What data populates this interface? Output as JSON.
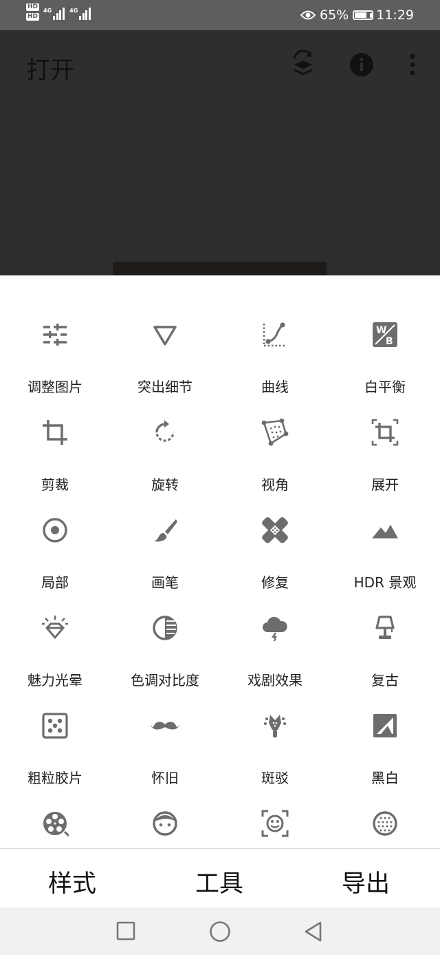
{
  "status_bar": {
    "sim1": "HD",
    "sim2": "HD",
    "net1": "4G",
    "net2": "4G",
    "battery_percent": "65%",
    "battery_level": 0.65,
    "time": "11:29",
    "icons": [
      "eye-comfort-icon",
      "battery-icon"
    ]
  },
  "top_bar": {
    "title": "打开",
    "icons": [
      "layers-undo-icon",
      "info-icon",
      "more-vert-icon"
    ]
  },
  "tools": [
    {
      "label": "调整图片",
      "icon": "tune-sliders-icon"
    },
    {
      "label": "突出细节",
      "icon": "triangle-details-icon"
    },
    {
      "label": "曲线",
      "icon": "curves-icon"
    },
    {
      "label": "白平衡",
      "icon": "white-balance-icon"
    },
    {
      "label": "剪裁",
      "icon": "crop-icon"
    },
    {
      "label": "旋转",
      "icon": "rotate-icon"
    },
    {
      "label": "视角",
      "icon": "perspective-icon"
    },
    {
      "label": "展开",
      "icon": "expand-icon"
    },
    {
      "label": "局部",
      "icon": "selective-icon"
    },
    {
      "label": "画笔",
      "icon": "brush-icon"
    },
    {
      "label": "修复",
      "icon": "healing-icon"
    },
    {
      "label": "HDR 景观",
      "icon": "hdr-mountain-icon"
    },
    {
      "label": "魅力光晕",
      "icon": "glamour-glow-icon"
    },
    {
      "label": "色调对比度",
      "icon": "tonal-contrast-icon"
    },
    {
      "label": "戏剧效果",
      "icon": "drama-cloud-icon"
    },
    {
      "label": "复古",
      "icon": "vintage-lamp-icon"
    },
    {
      "label": "粗粒胶片",
      "icon": "grainy-film-icon"
    },
    {
      "label": "怀旧",
      "icon": "mustache-icon"
    },
    {
      "label": "斑驳",
      "icon": "grunge-guitar-icon"
    },
    {
      "label": "黑白",
      "icon": "black-white-icon"
    },
    {
      "label": "",
      "icon": "film-reel-icon"
    },
    {
      "label": "",
      "icon": "face-icon"
    },
    {
      "label": "",
      "icon": "face-detect-icon"
    },
    {
      "label": "",
      "icon": "dotted-circle-icon"
    }
  ],
  "bottom_tabs": {
    "styles": "样式",
    "tools": "工具",
    "export": "导出"
  },
  "nav_bar": [
    "recents-square-icon",
    "home-circle-icon",
    "back-triangle-icon"
  ],
  "colors": {
    "status_bar_bg": "#5e5e5e",
    "top_bg": "#2e2e2e",
    "icon_gray": "#6d6d6d",
    "tab_text": "#111111"
  }
}
